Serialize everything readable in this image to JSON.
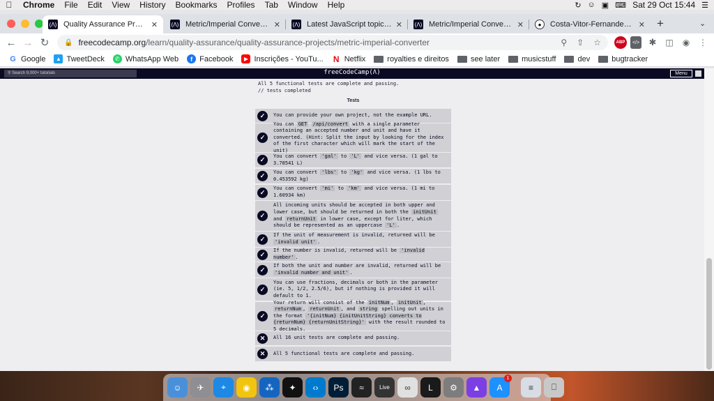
{
  "menubar": {
    "app": "Chrome",
    "items": [
      "File",
      "Edit",
      "View",
      "History",
      "Bookmarks",
      "Profiles",
      "Tab",
      "Window",
      "Help"
    ],
    "clock": "Sat 29 Oct  15:44"
  },
  "tabs": [
    {
      "label": "Quality Assurance Projects - f",
      "active": true,
      "icon": "freecodecamp-icon"
    },
    {
      "label": "Metric/Imperial Converter",
      "active": false,
      "icon": "freecodecamp-icon"
    },
    {
      "label": "Latest JavaScript topics - The",
      "active": false,
      "icon": "freecodecamp-icon"
    },
    {
      "label": "Metric/Imperial Converter",
      "active": false,
      "icon": "freecodecamp-icon"
    },
    {
      "label": "Costa-Vitor-Fernandes/boiler",
      "active": false,
      "icon": "github-icon"
    }
  ],
  "omnibox": {
    "host": "freecodecamp.org",
    "path": "/learn/quality-assurance/quality-assurance-projects/metric-imperial-converter"
  },
  "bookmarks": [
    {
      "label": "Google",
      "icon": "google-icon",
      "color": "#ffffff"
    },
    {
      "label": "TweetDeck",
      "icon": "tweetdeck-icon",
      "color": "#1da1f2"
    },
    {
      "label": "WhatsApp Web",
      "icon": "whatsapp-icon",
      "color": "#25d366"
    },
    {
      "label": "Facebook",
      "icon": "facebook-icon",
      "color": "#1877f2"
    },
    {
      "label": "Inscrições - YouTu...",
      "icon": "youtube-icon",
      "color": "#ff0000"
    },
    {
      "label": "Netflix",
      "icon": "netflix-icon",
      "color": "#e50914"
    },
    {
      "label": "royalties e direitos",
      "icon": "folder-icon",
      "color": "#5f6368"
    },
    {
      "label": "see later",
      "icon": "folder-icon",
      "color": "#5f6368"
    },
    {
      "label": "musicstuff",
      "icon": "folder-icon",
      "color": "#5f6368"
    },
    {
      "label": "dev",
      "icon": "folder-icon",
      "color": "#5f6368"
    },
    {
      "label": "bugtracker",
      "icon": "folder-icon",
      "color": "#5f6368"
    }
  ],
  "fcc": {
    "search_placeholder": "Search 9,000+ tutorials",
    "logo": "freeCodeCamp(Ʌ)",
    "menu": "Menu"
  },
  "hint_lines": [
    "All 5 functional tests are complete and passing.",
    "// tests completed"
  ],
  "tests_title": "Tests",
  "tests": [
    {
      "status": "pass",
      "parts": [
        {
          "t": "You can provide your own project, not the example URL."
        }
      ]
    },
    {
      "status": "pass",
      "parts": [
        {
          "t": "You can "
        },
        {
          "c": "GET"
        },
        {
          "t": " "
        },
        {
          "c": "/api/convert"
        },
        {
          "t": " with a single parameter containing an accepted number and unit and have it converted. (Hint: Split the input by looking for the index of the first character which will mark the start of the unit)"
        }
      ]
    },
    {
      "status": "pass",
      "parts": [
        {
          "t": "You can convert "
        },
        {
          "c": "'gal'"
        },
        {
          "t": " to "
        },
        {
          "c": "'L'"
        },
        {
          "t": " and vice versa. (1 gal to 3.78541 L)"
        }
      ]
    },
    {
      "status": "pass",
      "parts": [
        {
          "t": "You can convert "
        },
        {
          "c": "'lbs'"
        },
        {
          "t": " to "
        },
        {
          "c": "'kg'"
        },
        {
          "t": " and vice versa. (1 lbs to 0.453592 kg)"
        }
      ]
    },
    {
      "status": "pass",
      "parts": [
        {
          "t": "You can convert "
        },
        {
          "c": "'mi'"
        },
        {
          "t": " to "
        },
        {
          "c": "'km'"
        },
        {
          "t": " and vice versa. (1 mi to 1.60934 km)"
        }
      ]
    },
    {
      "status": "pass",
      "parts": [
        {
          "t": "All incoming units should be accepted in both upper and lower case, but should be returned in both the "
        },
        {
          "c": "initUnit"
        },
        {
          "t": " and "
        },
        {
          "c": "returnUnit"
        },
        {
          "t": " in lower case, except for liter, which should be represented as an uppercase "
        },
        {
          "c": "'L'"
        },
        {
          "t": "."
        }
      ]
    },
    {
      "status": "pass",
      "parts": [
        {
          "t": "If the unit of measurement is invalid, returned will be "
        },
        {
          "c": "'invalid unit'"
        },
        {
          "t": "."
        }
      ]
    },
    {
      "status": "pass",
      "parts": [
        {
          "t": "If the number is invalid, returned will be "
        },
        {
          "c": "'invalid number'"
        },
        {
          "t": "."
        }
      ]
    },
    {
      "status": "pass",
      "parts": [
        {
          "t": "If both the unit and number are invalid, returned will be "
        },
        {
          "c": "'invalid number and unit'"
        },
        {
          "t": "."
        }
      ]
    },
    {
      "status": "pass",
      "parts": [
        {
          "t": "You can use fractions, decimals or both in the parameter (ie. 5, 1/2, 2.5/6), but if nothing is provided it will default to 1."
        }
      ]
    },
    {
      "status": "pass",
      "parts": [
        {
          "t": "Your return will consist of the "
        },
        {
          "c": "initNum"
        },
        {
          "t": ", "
        },
        {
          "c": "initUnit"
        },
        {
          "t": ", "
        },
        {
          "c": "returnNum"
        },
        {
          "t": ", "
        },
        {
          "c": "returnUnit"
        },
        {
          "t": ", and "
        },
        {
          "c": "string"
        },
        {
          "t": " spelling out units in the format "
        },
        {
          "c": "'{initNum} {initUnitString} converts to {returnNum} {returnUnitString}'"
        },
        {
          "t": " with the result rounded to 5 decimals."
        }
      ]
    },
    {
      "status": "fail",
      "parts": [
        {
          "t": "All 16 unit tests are complete and passing."
        }
      ]
    },
    {
      "status": "fail",
      "parts": [
        {
          "t": "All 5 functional tests are complete and passing."
        }
      ]
    }
  ],
  "dock": {
    "apps": [
      {
        "name": "finder-icon",
        "color": "#4a90d9",
        "glyph": "☺"
      },
      {
        "name": "launchpad-icon",
        "color": "#8e8e93",
        "glyph": "✈"
      },
      {
        "name": "safari-icon",
        "color": "#1e88e5",
        "glyph": "⌖"
      },
      {
        "name": "chrome-icon",
        "color": "#f1c40f",
        "glyph": "◉"
      },
      {
        "name": "sourcetree-icon",
        "color": "#1565c0",
        "glyph": "⁂"
      },
      {
        "name": "tidal-icon",
        "color": "#111111",
        "glyph": "✦"
      },
      {
        "name": "vscode-icon",
        "color": "#007acc",
        "glyph": "‹›"
      },
      {
        "name": "photoshop-icon",
        "color": "#001e36",
        "glyph": "Ps"
      },
      {
        "name": "activity-monitor-icon",
        "color": "#222222",
        "glyph": "≈"
      },
      {
        "name": "ableton-live-icon",
        "color": "#333333",
        "glyph": "Live"
      },
      {
        "name": "network-icon",
        "color": "#e0e0e0",
        "glyph": "∞"
      },
      {
        "name": "league-icon",
        "color": "#1a1a1a",
        "glyph": "L"
      },
      {
        "name": "system-preferences-icon",
        "color": "#7d7d7d",
        "glyph": "⚙"
      },
      {
        "name": "affinity-icon",
        "color": "#7b3fe4",
        "glyph": "▲"
      },
      {
        "name": "app-store-icon",
        "color": "#1e90ff",
        "glyph": "A",
        "badge": "1"
      }
    ],
    "right": [
      {
        "name": "documents-icon",
        "color": "#d8dde5",
        "glyph": "≡"
      },
      {
        "name": "trash-icon",
        "color": "#c8c8c8",
        "glyph": "⎕"
      }
    ]
  },
  "colors": {
    "fcc_nav": "#0a0a23",
    "test_bg": "#d0d0d5",
    "code_bg": "#bfbfc4"
  }
}
